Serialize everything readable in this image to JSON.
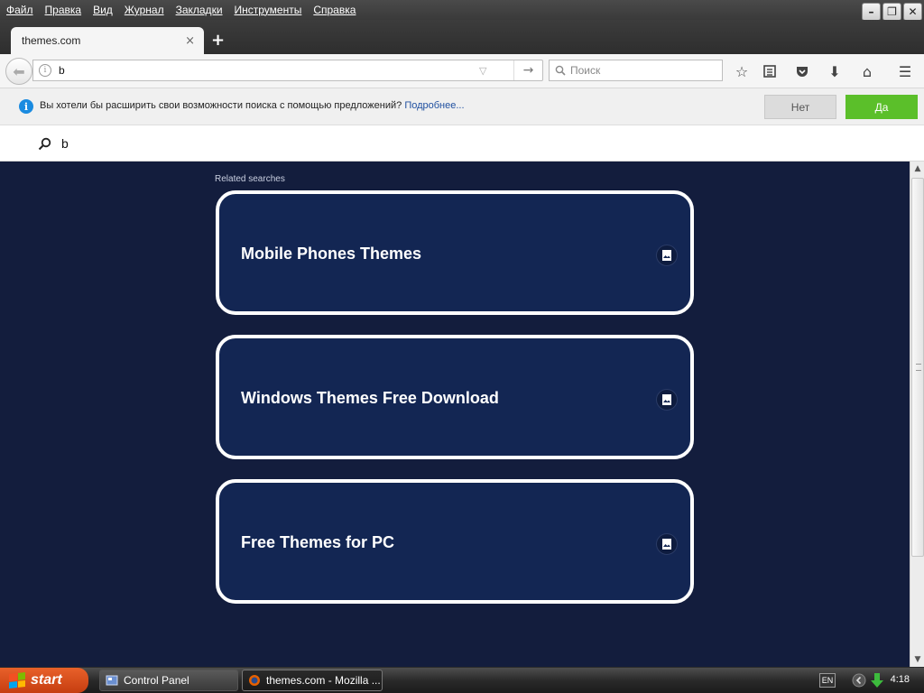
{
  "menubar": {
    "items": [
      "Файл",
      "Правка",
      "Вид",
      "Журнал",
      "Закладки",
      "Инструменты",
      "Справка"
    ]
  },
  "window_buttons": {
    "minimize": "–",
    "restore": "❐",
    "close": "✕"
  },
  "tab": {
    "title": "themes.com",
    "close": "×",
    "new_tab": "+"
  },
  "navbar": {
    "url_value": "b",
    "search_placeholder": "Поиск"
  },
  "notification": {
    "text": "Вы хотели бы расширить свои возможности поиска с помощью предложений?",
    "link": "Подробнее...",
    "no_label": "Нет",
    "yes_label": "Да"
  },
  "search_strip": {
    "query": "b"
  },
  "content": {
    "related_label": "Related searches",
    "cards": [
      {
        "label": "Mobile Phones Themes"
      },
      {
        "label": "Windows Themes Free Download"
      },
      {
        "label": "Free Themes for PC"
      }
    ]
  },
  "taskbar": {
    "start_label": "start",
    "tasks": [
      {
        "label": "Control Panel"
      },
      {
        "label": "themes.com - Mozilla ..."
      }
    ],
    "lang": "EN",
    "clock": "4:18"
  },
  "colors": {
    "content_bg": "#131d3d",
    "card_bg": "#132653",
    "card_border": "#ffffff",
    "yes_button": "#5bbf2a",
    "info_icon": "#1a8be0"
  }
}
